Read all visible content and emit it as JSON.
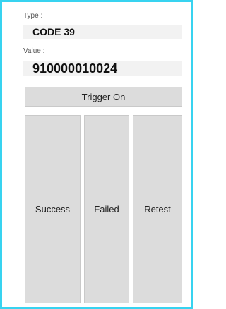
{
  "type_field": {
    "label": "Type :",
    "value": "CODE 39"
  },
  "value_field": {
    "label": "Value :",
    "value": "910000010024"
  },
  "buttons": {
    "trigger": "Trigger On",
    "success": "Success",
    "failed": "Failed",
    "retest": "Retest"
  },
  "colors": {
    "frame_border": "#38d3f0",
    "button_bg": "#dcdcdc",
    "field_bg": "#f2f2f2"
  }
}
